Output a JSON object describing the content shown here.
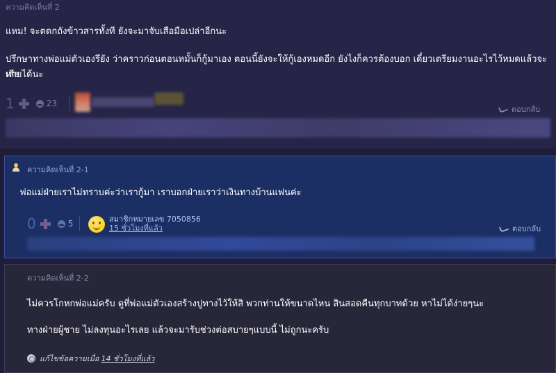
{
  "comments": [
    {
      "header": "ความคิดเห็นที่ 2",
      "paragraphs": [
        "แหม! จะตดกถังข้าวสารทั้งที ยังจะมาจับเสือมือเปล่าอีกนะ",
        "ปรึกษาทางพ่อแม่ตัวเองรึยัง ว่าคราวก่อนตอนหมั้นก็กู้มาเอง ตอนนี้ยังจะให้กู้เองหมดอีก ยังไงก็ควรต้องบอก เดี๋ยวเตรียมงานอะไรไว้หมดแล้วจะเสีย",
        "หายได้นะ"
      ],
      "votes": "1",
      "emotions": "23",
      "reply_label": "ตอบกลับ"
    },
    {
      "header": "ความคิดเห็นที่ 2-1",
      "paragraphs": [
        "พ่อแม่ฝ่ายเราไม่ทราบค่ะว่าเรากู้มา เราบอกฝ่ายเราว่าเงินทางบ้านแฟนค่ะ"
      ],
      "votes": "0",
      "emotions": "5",
      "member": "สมาชิกหมายเลข 7050856",
      "time": "15 ชั่วโมงที่แล้ว",
      "reply_label": "ตอบกลับ"
    },
    {
      "header": "ความคิดเห็นที่ 2-2",
      "paragraphs": [
        "ไม่ควรโกหกพ่อแม่ครับ ดูที่พ่อแม่ตัวเองสร้างปูทางไว้ให้สิ พวกท่านให้ขนาดไหน สินสอดคืนทุกบาทด้วย หาไม่ได้ง่ายๆนะ",
        "ทางฝ่ายผู้ชาย  ไม่ลงทุนอะไรเลย แล้วจะมารับช่วงต่อสบายๆแบบนี้ ไม่ถูกนะครับ"
      ],
      "edit_prefix": "แก้ไขข้อความเมื่อ",
      "edit_time": "14 ชั่วโมงที่แล้ว"
    }
  ],
  "icons": [
    "plus-icon",
    "emotion-icon",
    "reply-icon",
    "smiley-avatar-icon",
    "author-icon",
    "edit-icon"
  ]
}
